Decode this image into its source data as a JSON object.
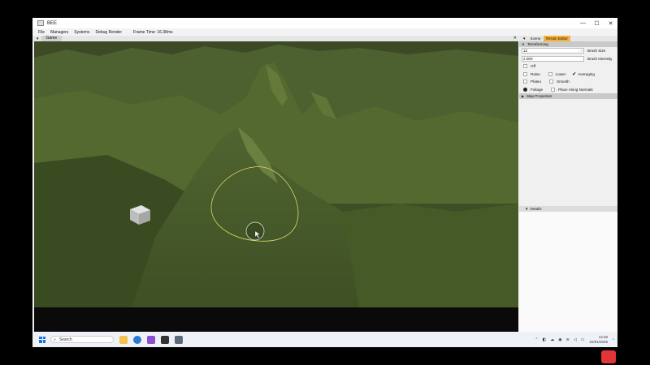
{
  "window": {
    "title": "BEE",
    "controls": {
      "minimize": "—",
      "maximize": "☐",
      "close": "✕"
    }
  },
  "menu": {
    "items": [
      "File",
      "Managers",
      "Systems",
      "Debug Render"
    ],
    "frame_time": "Frame Time: 16.38ms"
  },
  "game_panel": {
    "tab_label": "Game",
    "close": "✕",
    "scene_colors": {
      "terrain": "#4a5c2c",
      "terrain_light": "#5f7436",
      "brush": "#d9d86a"
    }
  },
  "right_panel": {
    "tabs": {
      "scene": "Scene",
      "terrain_editor": "Terrain Editor"
    },
    "terraforming": {
      "header": "Terraforming",
      "brush_size": {
        "value": "12",
        "label": "Brush Size",
        "stepper": "-  +"
      },
      "brush_intensity": {
        "value": "2.000",
        "label": "Brush Intensity"
      },
      "off_label": "Off",
      "raise_label": "Raise",
      "lower_label": "Lower",
      "averaging_label": "Averaging",
      "plateau_label": "Plateu",
      "smooth_label": "Smooth",
      "foliage_label": "Foliage",
      "place_normals_label": "Place Along Normals"
    },
    "map_properties_header": "Map Properties",
    "details_header": "Details"
  },
  "taskbar": {
    "search_placeholder": "Search",
    "time": "14:46",
    "date": "22/01/2025"
  }
}
